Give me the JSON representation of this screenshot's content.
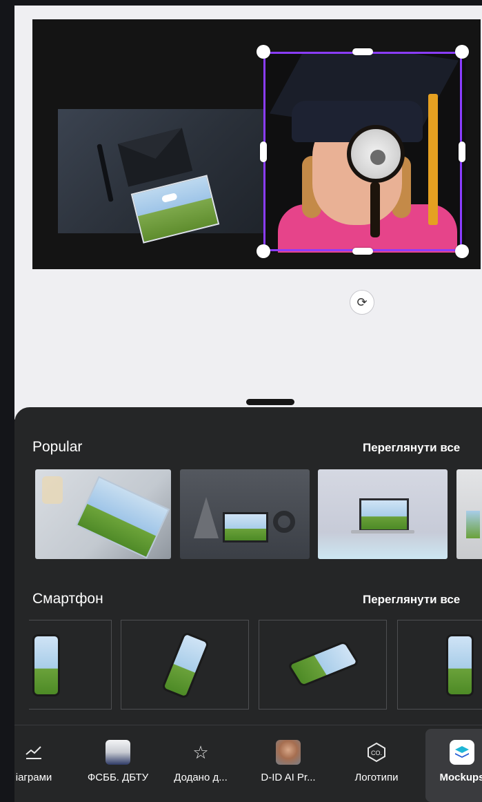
{
  "popular": {
    "title": "Popular",
    "see_all": "Переглянути все"
  },
  "smartphone": {
    "title": "Смартфон",
    "see_all": "Переглянути все"
  },
  "nav": {
    "items": [
      {
        "label": "іаграми",
        "icon": "line-chart-icon"
      },
      {
        "label": "ФСББ. ДБТУ",
        "icon": "folder-thumbnail"
      },
      {
        "label": "Додано д...",
        "icon": "star-icon"
      },
      {
        "label": "D-ID AI Pr...",
        "icon": "avatar-thumbnail"
      },
      {
        "label": "Логотипи",
        "icon": "co-logo-icon"
      },
      {
        "label": "Mockups",
        "icon": "mockups-layers-icon"
      }
    ]
  },
  "colors": {
    "selection": "#8b3dff",
    "panel": "#252627",
    "canvas_bg": "#efeff2"
  }
}
